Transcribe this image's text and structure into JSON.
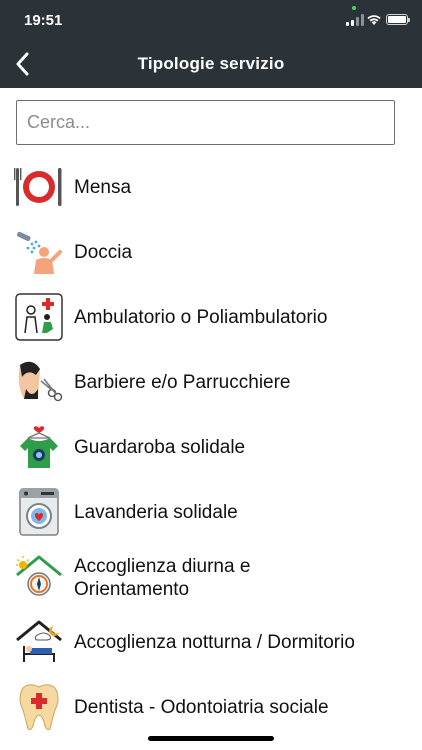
{
  "status_bar": {
    "time": "19:51"
  },
  "header": {
    "title": "Tipologie servizio"
  },
  "search": {
    "placeholder": "Cerca...",
    "value": ""
  },
  "services": [
    {
      "label": "Mensa",
      "icon": "plate-cutlery-icon"
    },
    {
      "label": "Doccia",
      "icon": "shower-icon"
    },
    {
      "label": "Ambulatorio o Poliambulatorio",
      "icon": "doctor-clinic-icon"
    },
    {
      "label": "Barbiere e/o Parrucchiere",
      "icon": "barber-scissors-icon"
    },
    {
      "label": "Guardaroba solidale",
      "icon": "tshirt-hanger-icon"
    },
    {
      "label": "Lavanderia solidale",
      "icon": "washing-machine-icon"
    },
    {
      "label": "Accoglienza diurna e Orientamento",
      "icon": "home-sun-compass-icon"
    },
    {
      "label": "Accoglienza notturna / Dormitorio",
      "icon": "home-moon-bed-icon"
    },
    {
      "label": "Dentista - Odontoiatria sociale",
      "icon": "tooth-cross-icon"
    }
  ],
  "colors": {
    "header_bg": "#2b3338",
    "accent_red": "#d92b2b",
    "accent_green": "#2e9e4a"
  }
}
